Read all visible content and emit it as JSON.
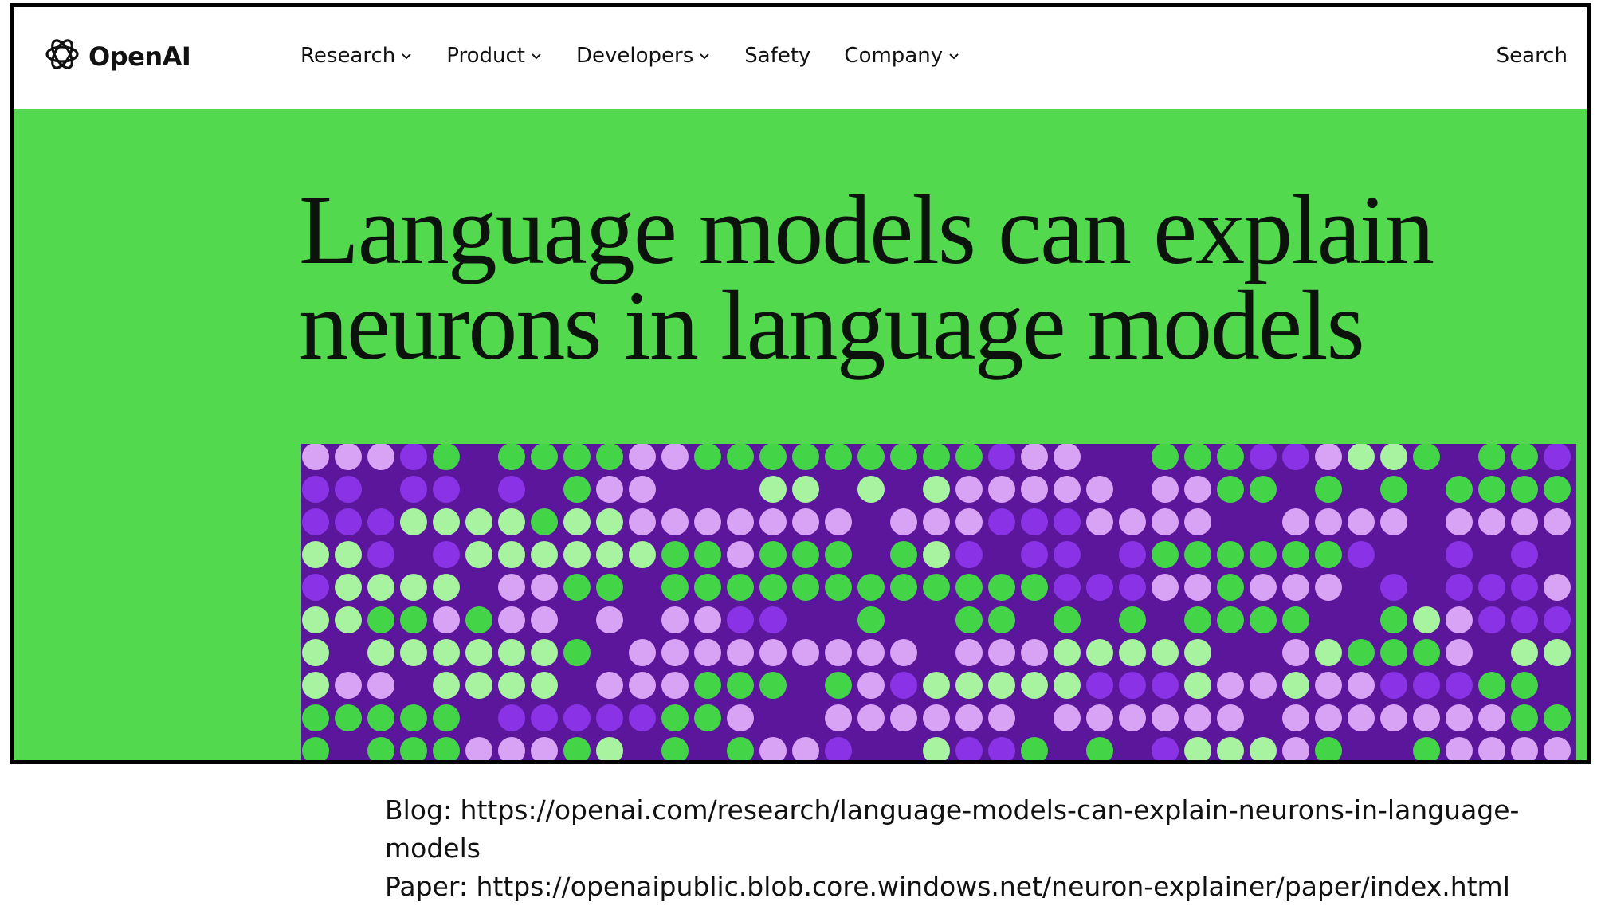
{
  "header": {
    "logo_text": "OpenAI",
    "nav": [
      {
        "label": "Research",
        "has_menu": true
      },
      {
        "label": "Product",
        "has_menu": true
      },
      {
        "label": "Developers",
        "has_menu": true
      },
      {
        "label": "Safety",
        "has_menu": false
      },
      {
        "label": "Company",
        "has_menu": true
      }
    ],
    "search_label": "Search"
  },
  "hero": {
    "title_line1": "Language models can explain",
    "title_line2": "neurons in language models",
    "background": "#52d94e",
    "art_background": "#5b169c",
    "dot_colors": [
      "#d8a2f5",
      "#8a33e6",
      "#43d448",
      "#a8f3a0"
    ]
  },
  "caption": {
    "blog": "Blog: https://openai.com/research/language-models-can-explain-neurons-in-language-models",
    "paper": "Paper: https://openaipublic.blob.core.windows.net/neuron-explainer/paper/index.html"
  }
}
